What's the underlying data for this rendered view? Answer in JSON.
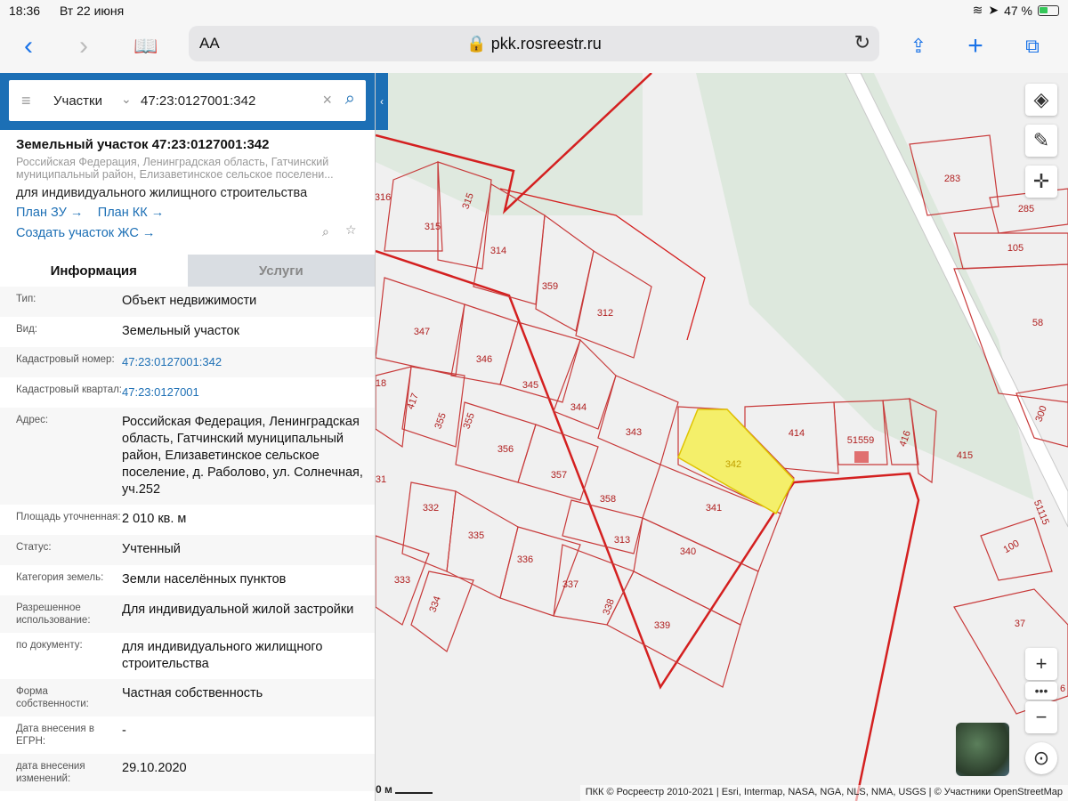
{
  "status_bar": {
    "time": "18:36",
    "date": "Вт 22 июня",
    "battery": "47 %"
  },
  "browser": {
    "text_size_label": "AA",
    "url": "pkk.rosreestr.ru"
  },
  "search": {
    "type_label": "Участки",
    "query": "47:23:0127001:342"
  },
  "object": {
    "title": "Земельный участок 47:23:0127001:342",
    "address_short": "Российская Федерация, Ленинградская область, Гатчинский муниципальный район, Елизаветинское сельское поселени...",
    "purpose": "для индивидуального жилищного строительства",
    "link_plan_zu": "План ЗУ",
    "link_plan_kk": "План КК",
    "link_create": "Создать участок ЖС"
  },
  "tabs": {
    "info": "Информация",
    "services": "Услуги"
  },
  "info": [
    {
      "label": "Тип:",
      "value": "Объект недвижимости"
    },
    {
      "label": "Вид:",
      "value": "Земельный участок"
    },
    {
      "label": "Кадастровый номер:",
      "value": "47:23:0127001:342"
    },
    {
      "label": "Кадастровый квартал:",
      "value": "47:23:0127001"
    },
    {
      "label": "Адрес:",
      "value": "Российская Федерация, Ленинградская область, Гатчинский муниципальный район, Елизаветинское сельское поселение, д. Раболово, ул. Солнечная, уч.252"
    },
    {
      "label": "Площадь уточненная:",
      "value": "2 010 кв. м"
    },
    {
      "label": "Статус:",
      "value": "Учтенный"
    },
    {
      "label": "Категория земель:",
      "value": "Земли населённых пунктов"
    },
    {
      "label": "Разрешенное использование:",
      "value": "Для индивидуальной жилой застройки"
    },
    {
      "label": "по документу:",
      "value": "для индивидуального жилищного строительства"
    },
    {
      "label": "Форма собственности:",
      "value": "Частная собственность"
    },
    {
      "label": "Дата внесения в ЕГРН:",
      "value": "-"
    },
    {
      "label": "дата внесения изменений:",
      "value": "29.10.2020"
    }
  ],
  "map": {
    "scale_label": "0 м",
    "attribution": "ПКК © Росреестр 2010-2021 | Esri, Intermap, NASA, NGA, NLS, NMA, USGS | © Участники OpenStreetMap",
    "selected_parcel": "342",
    "parcel_labels": [
      "316",
      "315",
      "315",
      "314",
      "359",
      "312",
      "347",
      "346",
      "345",
      "344",
      "343",
      "342",
      "341",
      "340",
      "339",
      "338",
      "337",
      "336",
      "335",
      "332",
      "333",
      "334",
      "356",
      "357",
      "358",
      "313",
      "355",
      "355",
      "417",
      "18",
      "31",
      "414",
      "51559",
      "416",
      "415",
      "283",
      "285",
      "105",
      "58",
      "300",
      "51115",
      "100",
      "37",
      "6"
    ]
  },
  "colors": {
    "accent": "#1c6fb5",
    "parcel_border": "#d42020",
    "selected_fill": "#f4ef6a"
  }
}
